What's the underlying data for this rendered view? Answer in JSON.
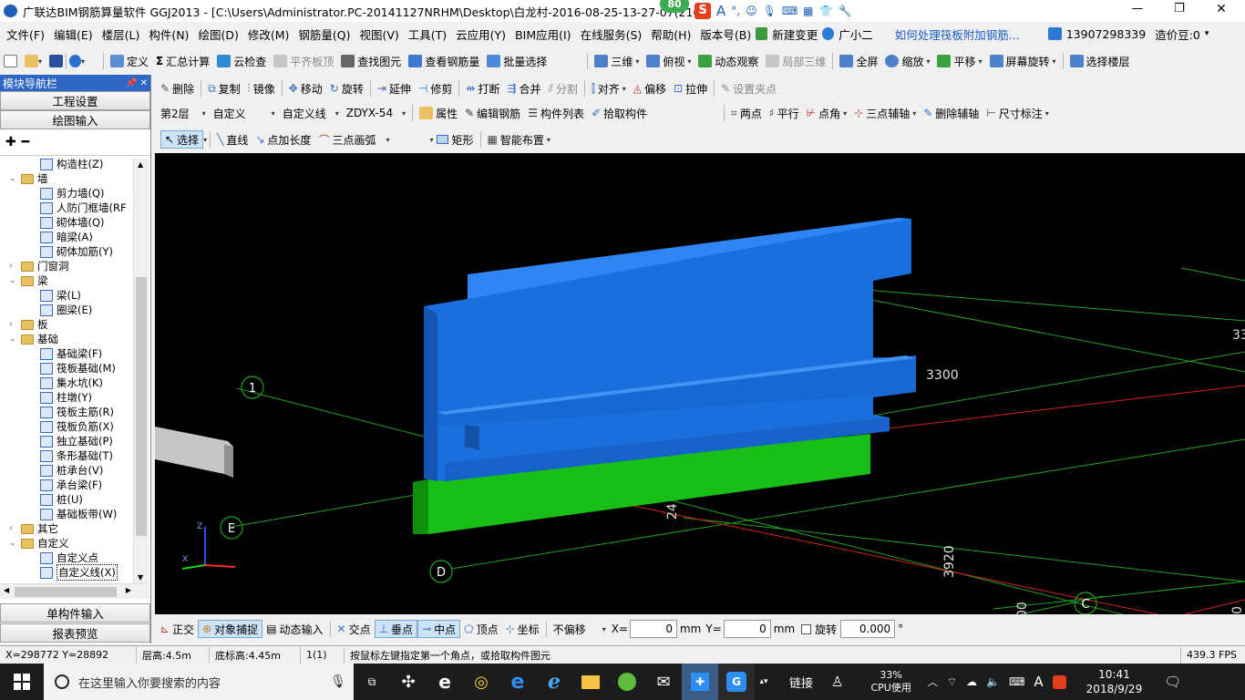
{
  "window": {
    "title": "广联达BIM钢筋算量软件 GGJ2013 - [C:\\Users\\Administrator.PC-20141127NRHM\\Desktop\\白龙村-2016-08-25-13-27-07(216",
    "badge": "80",
    "controls": [
      "—",
      "❐",
      "✕"
    ]
  },
  "menu": [
    "文件(F)",
    "编辑(E)",
    "楼层(L)",
    "构件(N)",
    "绘图(D)",
    "修改(M)",
    "钢筋量(Q)",
    "视图(V)",
    "工具(T)",
    "云应用(Y)",
    "BIM应用(I)",
    "在线服务(S)",
    "帮助(H)",
    "版本号(B)",
    "新建变更",
    "广小二",
    "如何处理筏板附加钢筋..."
  ],
  "menu_right": {
    "phone": "13907298339",
    "price": "造价豆:0"
  },
  "toolbar1": [
    "定义",
    "汇总计算",
    "云检查",
    "平齐板顶",
    "查找图元",
    "查看钢筋量",
    "批量选择",
    "三维",
    "俯视",
    "动态观察",
    "局部三维",
    "全屏",
    "缩放",
    "平移",
    "屏幕旋转",
    "选择楼层"
  ],
  "toolbar2": [
    "删除",
    "复制",
    "镜像",
    "移动",
    "旋转",
    "延伸",
    "修剪",
    "打断",
    "合并",
    "分割",
    "对齐",
    "偏移",
    "拉伸",
    "设置夹点"
  ],
  "toolbar3": {
    "floor": "第2层",
    "type1": "自定义",
    "type2": "自定义线",
    "code": "ZDYX-54",
    "items": [
      "属性",
      "编辑钢筋",
      "构件列表",
      "拾取构件"
    ],
    "right": [
      "两点",
      "平行",
      "点角",
      "三点辅轴",
      "删除辅轴",
      "尺寸标注"
    ]
  },
  "toolbar4": [
    "选择",
    "直线",
    "点加长度",
    "三点画弧",
    "矩形",
    "智能布置"
  ],
  "nav": {
    "title": "模块导航栏",
    "pin": "📌 ✕",
    "btn1": "工程设置",
    "btn2": "绘图输入",
    "btn3": "单构件输入",
    "btn4": "报表预览"
  },
  "tree": [
    {
      "label": "构造柱(Z)",
      "level": 2,
      "type": "leaf"
    },
    {
      "label": "墙",
      "level": 1,
      "type": "folder",
      "open": true
    },
    {
      "label": "剪力墙(Q)",
      "level": 2,
      "type": "leaf"
    },
    {
      "label": "人防门框墙(RF",
      "level": 2,
      "type": "leaf"
    },
    {
      "label": "砌体墙(Q)",
      "level": 2,
      "type": "leaf"
    },
    {
      "label": "暗梁(A)",
      "level": 2,
      "type": "leaf"
    },
    {
      "label": "砌体加筋(Y)",
      "level": 2,
      "type": "leaf"
    },
    {
      "label": "门窗洞",
      "level": 1,
      "type": "folder",
      "open": false
    },
    {
      "label": "梁",
      "level": 1,
      "type": "folder",
      "open": true
    },
    {
      "label": "梁(L)",
      "level": 2,
      "type": "leaf"
    },
    {
      "label": "圈梁(E)",
      "level": 2,
      "type": "leaf"
    },
    {
      "label": "板",
      "level": 1,
      "type": "folder",
      "open": false
    },
    {
      "label": "基础",
      "level": 1,
      "type": "folder",
      "open": true
    },
    {
      "label": "基础梁(F)",
      "level": 2,
      "type": "leaf"
    },
    {
      "label": "筏板基础(M)",
      "level": 2,
      "type": "leaf"
    },
    {
      "label": "集水坑(K)",
      "level": 2,
      "type": "leaf"
    },
    {
      "label": "柱墩(Y)",
      "level": 2,
      "type": "leaf"
    },
    {
      "label": "筏板主筋(R)",
      "level": 2,
      "type": "leaf"
    },
    {
      "label": "筏板负筋(X)",
      "level": 2,
      "type": "leaf"
    },
    {
      "label": "独立基础(P)",
      "level": 2,
      "type": "leaf"
    },
    {
      "label": "条形基础(T)",
      "level": 2,
      "type": "leaf"
    },
    {
      "label": "桩承台(V)",
      "level": 2,
      "type": "leaf"
    },
    {
      "label": "承台梁(F)",
      "level": 2,
      "type": "leaf"
    },
    {
      "label": "桩(U)",
      "level": 2,
      "type": "leaf"
    },
    {
      "label": "基础板带(W)",
      "level": 2,
      "type": "leaf"
    },
    {
      "label": "其它",
      "level": 1,
      "type": "folder",
      "open": false
    },
    {
      "label": "自定义",
      "level": 1,
      "type": "folder",
      "open": true
    },
    {
      "label": "自定义点",
      "level": 2,
      "type": "leaf"
    },
    {
      "label": "自定义线(X)",
      "level": 2,
      "type": "leaf",
      "selected": true
    }
  ],
  "viewport": {
    "axis_labels": [
      "1",
      "E",
      "D",
      "C"
    ],
    "dims": [
      "3300",
      "33",
      "24",
      "3920",
      "00",
      "0"
    ]
  },
  "snapbar": {
    "items": [
      "正交",
      "对象捕捉",
      "动态输入",
      "交点",
      "垂点",
      "中点",
      "顶点",
      "坐标"
    ],
    "offset": "不偏移",
    "x_label": "X=",
    "x_value": "0",
    "unit": "mm",
    "y_label": "Y=",
    "y_value": "0",
    "rotate_label": "旋转",
    "rotate_value": "0.000",
    "deg": "°"
  },
  "status": {
    "coords": "X=298772  Y=28892",
    "floor_height": "层高:4.5m",
    "base_height": "底标高:4.45m",
    "count": "1(1)",
    "hint": "按鼠标左键指定第一个角点，或拾取构件图元",
    "fps": "439.3 FPS"
  },
  "taskbar": {
    "search": "在这里输入你要搜索的内容",
    "link": "链接",
    "cpu_pct": "33%",
    "cpu_label": "CPU使用",
    "time": "10:41",
    "date": "2018/9/29",
    "ime": "A"
  }
}
